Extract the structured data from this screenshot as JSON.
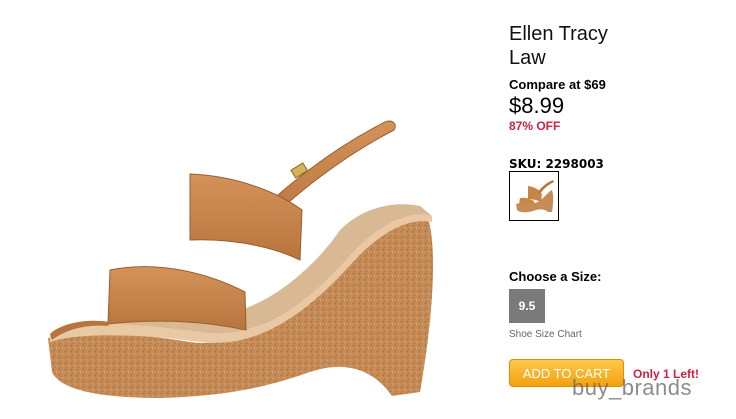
{
  "product": {
    "brand": "Ellen Tracy",
    "name": "Law",
    "compare_at": "Compare at $69",
    "price": "$8.99",
    "discount": "87% OFF",
    "sku": "SKU: 2298003"
  },
  "sizes": {
    "title": "Choose a Size:",
    "options": [
      "9.5"
    ],
    "chart_link": "Shoe Size Chart"
  },
  "cart": {
    "button_label": "ADD TO CART",
    "stock_note": "Only 1 Left!"
  },
  "watermark": "buy_brands",
  "colors": {
    "accent_red": "#cc2244",
    "cart_button": "#f4a10d",
    "size_button": "#7a7a7a",
    "shoe_leather": "#c98545",
    "cork_wedge": "#c58c55"
  }
}
